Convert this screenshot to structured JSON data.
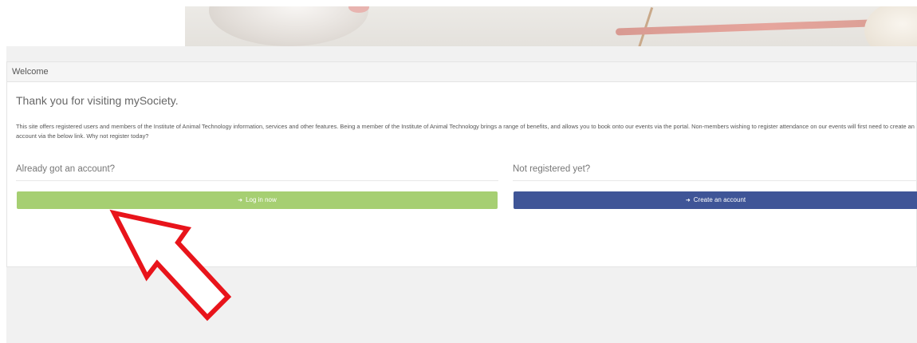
{
  "panel": {
    "heading": "Welcome",
    "title": "Thank you for visiting mySociety.",
    "intro": "This site offers registered users and members of the Institute of Animal Technology information, services and other features. Being a member of the Institute of Animal Technology brings a range of benefits, and allows you to book onto our events via the portal. Non-members wishing to register attendance on our events will first need to create an account via the below link. Why not register today?"
  },
  "login_section": {
    "heading": "Already got an account?",
    "button_label": "Log in now",
    "icon": "sign-in-icon"
  },
  "register_section": {
    "heading": "Not registered yet?",
    "button_label": "Create an account",
    "icon": "sign-in-icon"
  },
  "colors": {
    "login_button": "#a6cf72",
    "create_button": "#3f5597",
    "annotation_arrow": "#e8141b"
  }
}
